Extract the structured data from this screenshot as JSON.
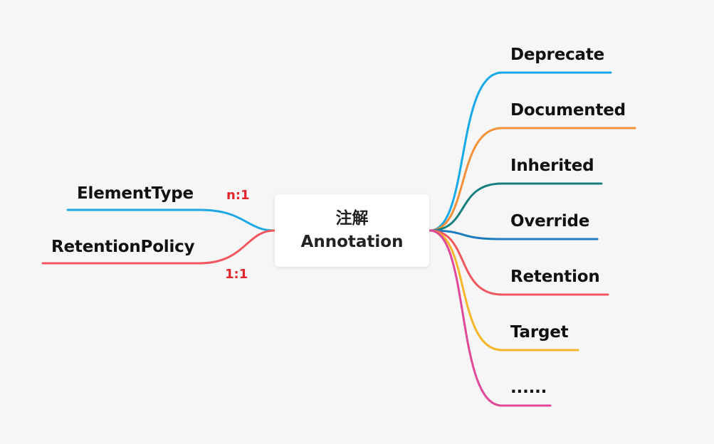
{
  "central": {
    "line1": "注解",
    "line2": "Annotation"
  },
  "left_topics": [
    {
      "label": "ElementType",
      "color": "#1ea7e4"
    },
    {
      "label": "RetentionPolicy",
      "color": "#f1575e"
    }
  ],
  "relations": [
    "n:1",
    "1:1"
  ],
  "right_topics": [
    {
      "label": "Deprecate",
      "color": "#18a9e8"
    },
    {
      "label": "Documented",
      "color": "#f2913a"
    },
    {
      "label": "Inherited",
      "color": "#17807e"
    },
    {
      "label": "Override",
      "color": "#1d7bc0"
    },
    {
      "label": "Retention",
      "color": "#f1575e"
    },
    {
      "label": "Target",
      "color": "#f5b62a"
    },
    {
      "label": "......",
      "color": "#e0489a"
    }
  ]
}
